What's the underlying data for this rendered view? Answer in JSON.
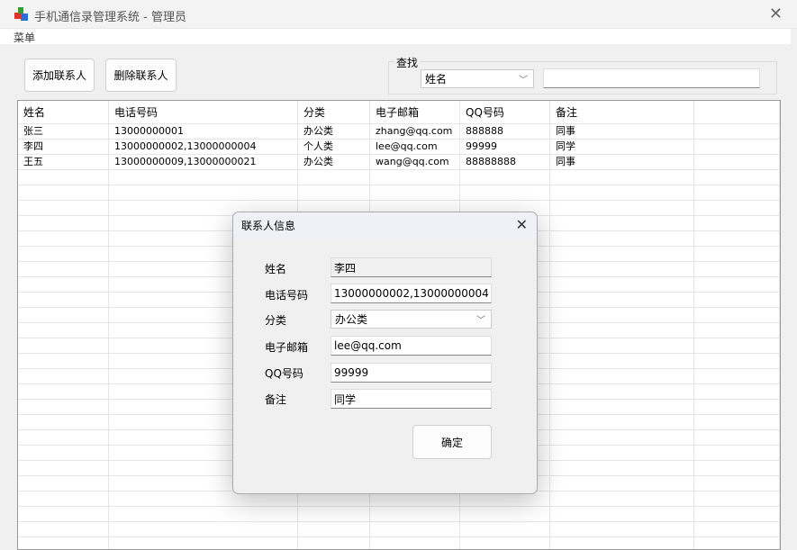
{
  "window": {
    "title": "手机通信录管理系统 - 管理员",
    "menu": "菜单"
  },
  "toolbar": {
    "add": "添加联系人",
    "delete": "删除联系人"
  },
  "search": {
    "group_label": "查找",
    "field": "姓名",
    "query": ""
  },
  "table": {
    "columns": [
      "姓名",
      "电话号码",
      "分类",
      "电子邮箱",
      "QQ号码",
      "备注"
    ],
    "rows": [
      [
        "张三",
        "13000000001",
        "办公类",
        "zhang@qq.com",
        "888888",
        "同事"
      ],
      [
        "李四",
        "13000000002,13000000004",
        "个人类",
        "lee@qq.com",
        "99999",
        "同学"
      ],
      [
        "王五",
        "13000000009,13000000021",
        "办公类",
        "wang@qq.com",
        "88888888",
        "同事"
      ]
    ]
  },
  "dialog": {
    "title": "联系人信息",
    "labels": {
      "name": "姓名",
      "phone": "电话号码",
      "category": "分类",
      "email": "电子邮箱",
      "qq": "QQ号码",
      "note": "备注"
    },
    "values": {
      "name": "李四",
      "phone": "13000000002,13000000004",
      "category": "办公类",
      "email": "lee@qq.com",
      "qq": "99999",
      "note": "同学"
    },
    "ok": "确定"
  }
}
